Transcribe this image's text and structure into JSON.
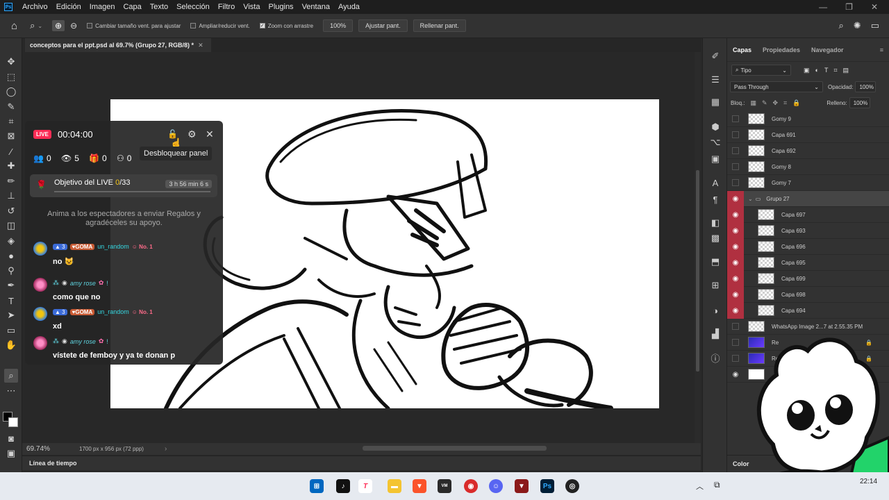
{
  "menu": {
    "logo": "Ps",
    "items": [
      "Archivo",
      "Edición",
      "Imagen",
      "Capa",
      "Texto",
      "Selección",
      "Filtro",
      "Vista",
      "Plugins",
      "Ventana",
      "Ayuda"
    ]
  },
  "options": {
    "resize_windows": "Cambiar tamaño vent. para ajustar",
    "zoom_all": "Ampliar/reducir vent.",
    "scrubby_zoom": "Zoom con arrastre",
    "zoom_value": "100%",
    "fit_screen": "Ajustar pant.",
    "fill_screen": "Rellenar pant."
  },
  "document": {
    "tab_title": "conceptos para el ppt.psd al 69.7% (Grupo 27, RGB/8) *",
    "zoom": "69.74%",
    "dimensions": "1700 px x 956 px (72 ppp)"
  },
  "timeline": {
    "label": "Línea de tiempo"
  },
  "layers_panel": {
    "tabs": [
      "Capas",
      "Propiedades",
      "Navegador"
    ],
    "filter_kind": "Tipo",
    "blend_mode": "Pass Through",
    "opacity_label": "Opacidad:",
    "opacity_value": "100%",
    "lock_label": "Bloq.:",
    "fill_label": "Relleno:",
    "fill_value": "100%",
    "layers": [
      {
        "name": "Gomy 9",
        "visible": false,
        "indent": false
      },
      {
        "name": "Capa 691",
        "visible": false,
        "indent": false
      },
      {
        "name": "Capa 692",
        "visible": false,
        "indent": false
      },
      {
        "name": "Gomy 8",
        "visible": false,
        "indent": false
      },
      {
        "name": "Gomy 7",
        "visible": false,
        "indent": false
      },
      {
        "name": "Grupo 27",
        "visible": true,
        "indent": false,
        "group": true
      },
      {
        "name": "Capa 697",
        "visible": true,
        "indent": true
      },
      {
        "name": "Capa 693",
        "visible": true,
        "indent": true
      },
      {
        "name": "Capa 696",
        "visible": true,
        "indent": true
      },
      {
        "name": "Capa 695",
        "visible": true,
        "indent": true
      },
      {
        "name": "Capa 699",
        "visible": true,
        "indent": true
      },
      {
        "name": "Capa 698",
        "visible": true,
        "indent": true
      },
      {
        "name": "Capa 694",
        "visible": true,
        "indent": true
      },
      {
        "name": "WhatsApp Image 2...7 at 2.55.35 PM",
        "visible": false,
        "indent": false
      },
      {
        "name": "Re",
        "visible": false,
        "indent": false,
        "locked": true
      },
      {
        "name": "Re",
        "visible": false,
        "indent": false,
        "locked": true
      }
    ]
  },
  "color_panel": {
    "label": "Color"
  },
  "live": {
    "badge": "LIVE",
    "timer": "00:04:00",
    "stats": {
      "followers": "0",
      "viewers": "5",
      "gifts": "0",
      "joins": "0"
    },
    "tooltip": "Desbloquear panel",
    "goal_label": "Objetivo del LIVE",
    "goal_current": "0",
    "goal_total": "/33",
    "goal_time": "3 h 56 min 6 s",
    "goal_progress": 0,
    "hint": "Anima a los espectadores a enviar Regalos y agradéceles su apoyo.",
    "messages": [
      {
        "level": "3",
        "fan_badge": "GOMA",
        "user": "un_random",
        "rank": "No. 1",
        "text": "no"
      },
      {
        "user": "amy rose",
        "text": "como que no"
      },
      {
        "level": "3",
        "fan_badge": "GOMA",
        "user": "un_random",
        "rank": "No. 1",
        "text": "xd"
      },
      {
        "user": "amy rose",
        "text": "vístete de femboy y ya te donan p"
      }
    ]
  },
  "taskbar": {
    "time": "22:14"
  },
  "colors": {
    "live_red": "#fe2c55",
    "layer_eye_red": "#b03040",
    "ps_blue": "#31a8ff"
  }
}
